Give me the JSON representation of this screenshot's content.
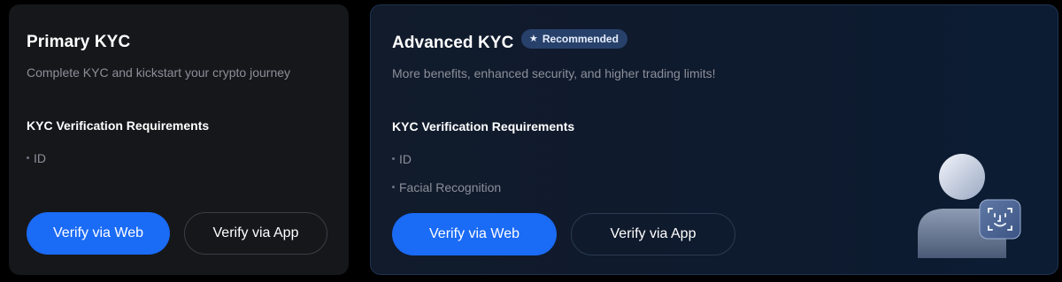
{
  "primary": {
    "title": "Primary KYC",
    "subtitle": "Complete KYC and kickstart your crypto journey",
    "requirements_heading": "KYC Verification Requirements",
    "requirements": [
      "ID"
    ],
    "verify_web_label": "Verify via Web",
    "verify_app_label": "Verify via App"
  },
  "advanced": {
    "title": "Advanced KYC",
    "badge": {
      "icon": "star-icon",
      "label": "Recommended"
    },
    "subtitle": "More benefits, enhanced security, and higher trading limits!",
    "requirements_heading": "KYC Verification Requirements",
    "requirements": [
      "ID",
      "Facial Recognition"
    ],
    "verify_web_label": "Verify via Web",
    "verify_app_label": "Verify via App",
    "illustration": "face-recognition-user-icon"
  },
  "colors": {
    "primary_button": "#1a6bf5",
    "badge_bg": "#27416b",
    "muted_text": "#8c8f99"
  }
}
